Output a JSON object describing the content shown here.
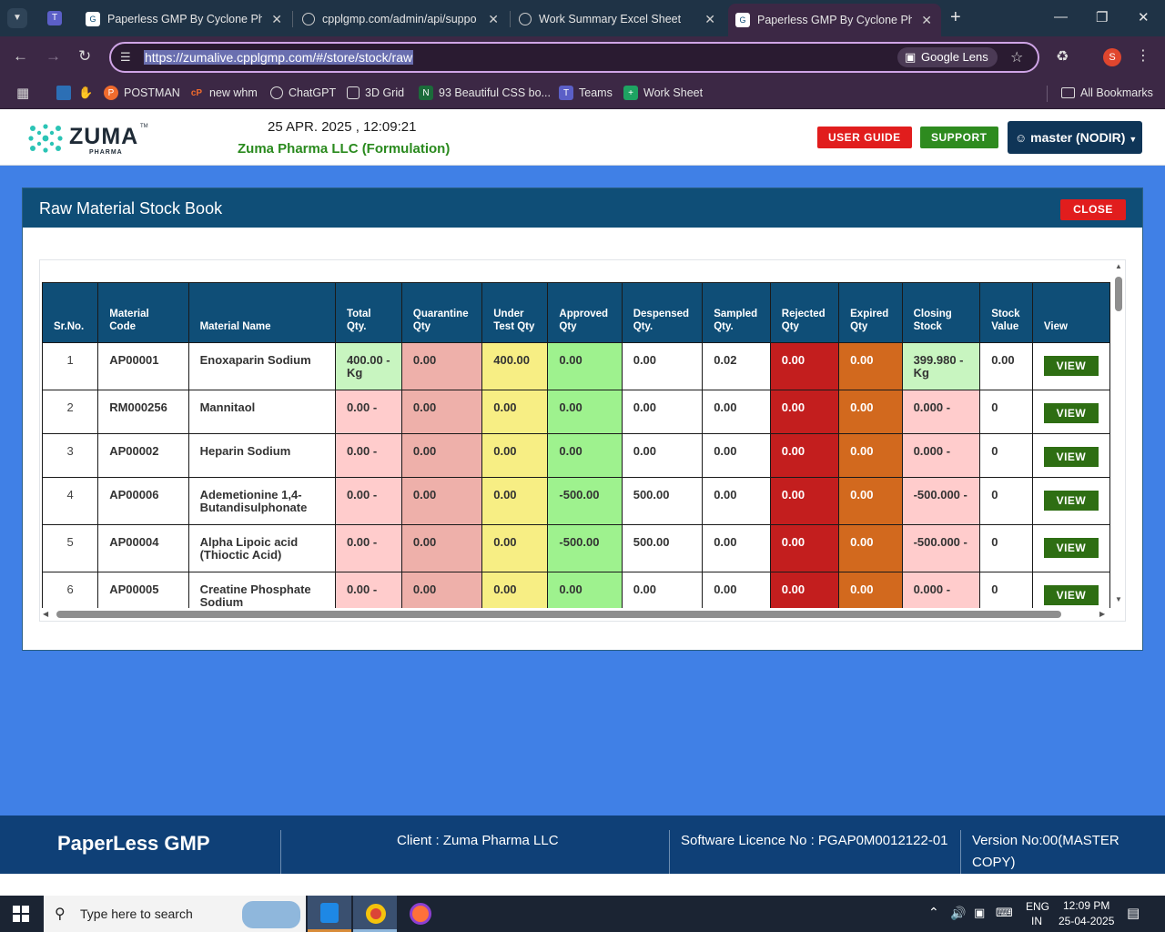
{
  "browser": {
    "tabs": [
      {
        "title": "Paperless GMP By Cyclone Phar",
        "active": false
      },
      {
        "title": "cpplgmp.com/admin/api/suppo",
        "active": false
      },
      {
        "title": "Work Summary Excel Sheet",
        "active": false
      },
      {
        "title": "Paperless GMP By Cyclone Phar",
        "active": true
      }
    ],
    "url": "https://zumalive.cpplgmp.com/#/store/stock/raw",
    "lens_label": "Google Lens",
    "profile_initial": "S",
    "bookmarks": [
      "POSTMAN",
      "new whm",
      "ChatGPT",
      "3D Grid",
      "93 Beautiful CSS bo...",
      "Teams",
      "Work Sheet"
    ],
    "all_bookmarks": "All Bookmarks"
  },
  "header": {
    "logo_text": "ZUMA",
    "logo_tm": "TM",
    "logo_sub": "PHARMA",
    "datetime": "25 APR. 2025 , 12:09:21",
    "company": "Zuma Pharma LLC (Formulation)",
    "user_guide": "USER GUIDE",
    "support": "SUPPORT",
    "user": "master (NODIR)"
  },
  "modal": {
    "title": "Raw Material Stock Book",
    "close": "CLOSE",
    "columns": [
      {
        "key": "sr",
        "label": "Sr.No."
      },
      {
        "key": "code",
        "label": "Material Code"
      },
      {
        "key": "name",
        "label": "Material Name"
      },
      {
        "key": "total",
        "label": "Total Qty."
      },
      {
        "key": "quar",
        "label": "Quarantine Qty"
      },
      {
        "key": "test",
        "label": "Under Test Qty"
      },
      {
        "key": "appr",
        "label": "Approved Qty"
      },
      {
        "key": "desp",
        "label": "Despensed Qty."
      },
      {
        "key": "samp",
        "label": "Sampled Qty."
      },
      {
        "key": "rej",
        "label": "Rejected Qty"
      },
      {
        "key": "exp",
        "label": "Expired Qty"
      },
      {
        "key": "close",
        "label": "Closing Stock"
      },
      {
        "key": "value",
        "label": "Stock Value"
      },
      {
        "key": "view",
        "label": "View"
      }
    ],
    "view_label": "VIEW",
    "rows": [
      {
        "sr": "1",
        "code": "AP00001",
        "name": "Enoxaparin Sodium",
        "total": "400.00 - Kg",
        "quar": "0.00",
        "test": "400.00",
        "appr": "0.00",
        "desp": "0.00",
        "samp": "0.02",
        "rej": "0.00",
        "exp": "0.00",
        "close": "399.980 - Kg",
        "value": "0.00",
        "in_stock": true
      },
      {
        "sr": "2",
        "code": "RM000256",
        "name": "Mannitaol",
        "total": "0.00 -",
        "quar": "0.00",
        "test": "0.00",
        "appr": "0.00",
        "desp": "0.00",
        "samp": "0.00",
        "rej": "0.00",
        "exp": "0.00",
        "close": "0.000 -",
        "value": "0",
        "in_stock": false
      },
      {
        "sr": "3",
        "code": "AP00002",
        "name": "Heparin Sodium",
        "total": "0.00 -",
        "quar": "0.00",
        "test": "0.00",
        "appr": "0.00",
        "desp": "0.00",
        "samp": "0.00",
        "rej": "0.00",
        "exp": "0.00",
        "close": "0.000 -",
        "value": "0",
        "in_stock": false
      },
      {
        "sr": "4",
        "code": "AP00006",
        "name": "Ademetionine 1,4-Butandisulphonate",
        "total": "0.00 -",
        "quar": "0.00",
        "test": "0.00",
        "appr": "-500.00",
        "desp": "500.00",
        "samp": "0.00",
        "rej": "0.00",
        "exp": "0.00",
        "close": "-500.000 -",
        "value": "0",
        "in_stock": false
      },
      {
        "sr": "5",
        "code": "AP00004",
        "name": "Alpha Lipoic acid (Thioctic Acid)",
        "total": "0.00 -",
        "quar": "0.00",
        "test": "0.00",
        "appr": "-500.00",
        "desp": "500.00",
        "samp": "0.00",
        "rej": "0.00",
        "exp": "0.00",
        "close": "-500.000 -",
        "value": "0",
        "in_stock": false
      },
      {
        "sr": "6",
        "code": "AP00005",
        "name": "Creatine Phosphate Sodium",
        "total": "0.00 -",
        "quar": "0.00",
        "test": "0.00",
        "appr": "0.00",
        "desp": "0.00",
        "samp": "0.00",
        "rej": "0.00",
        "exp": "0.00",
        "close": "0.000 -",
        "value": "0",
        "in_stock": false
      }
    ]
  },
  "footer": {
    "brand": "PaperLess GMP",
    "client": "Client : Zuma Pharma LLC",
    "licence": "Software Licence No : PGAP0M0012122-01",
    "version": "Version No:00(MASTER COPY)"
  },
  "taskbar": {
    "search_placeholder": "Type here to search",
    "lang": "ENG",
    "region": "IN",
    "time": "12:09 PM",
    "date": "25-04-2025"
  },
  "colors": {
    "accent": "#0f4e77",
    "page_bg": "#4080e6",
    "danger": "#e11d1d",
    "success": "#2e8b1f"
  }
}
